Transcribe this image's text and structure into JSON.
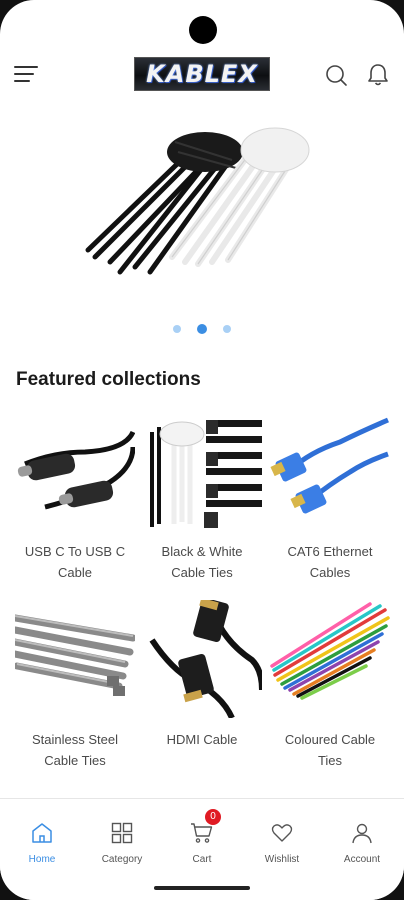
{
  "header": {
    "logo_text": "KABLEX",
    "icons": [
      "menu-icon",
      "search-icon",
      "bell-icon"
    ]
  },
  "carousel": {
    "slide_count": 3,
    "active_index": 1
  },
  "featured": {
    "title": "Featured collections",
    "items": [
      {
        "label": "USB C To USB C Cable",
        "icon": "usb-c-cable"
      },
      {
        "label": "Black & White Cable Ties",
        "icon": "cable-ties"
      },
      {
        "label": "CAT6 Ethernet Cables",
        "icon": "ethernet-cable"
      },
      {
        "label": "Stainless Steel Cable Ties",
        "icon": "steel-ties"
      },
      {
        "label": "HDMI Cable",
        "icon": "hdmi-cable"
      },
      {
        "label": "Coloured Cable Ties",
        "icon": "coloured-ties"
      }
    ]
  },
  "bottom_nav": {
    "items": [
      {
        "label": "Home",
        "icon": "home-icon",
        "active": true
      },
      {
        "label": "Category",
        "icon": "grid-icon",
        "active": false
      },
      {
        "label": "Cart",
        "icon": "cart-icon",
        "active": false
      },
      {
        "label": "Wishlist",
        "icon": "heart-icon",
        "active": false
      },
      {
        "label": "Account",
        "icon": "user-icon",
        "active": false
      }
    ],
    "cart_count": "0"
  },
  "colors": {
    "accent": "#3b8ee3",
    "badge": "#e01b24",
    "dot_inactive": "#a9d0f5"
  }
}
